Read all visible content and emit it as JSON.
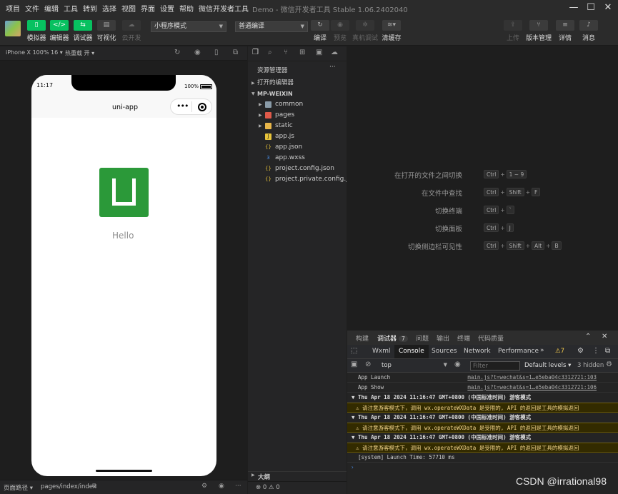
{
  "menu": [
    "项目",
    "文件",
    "编辑",
    "工具",
    "转到",
    "选择",
    "视图",
    "界面",
    "设置",
    "帮助",
    "微信开发者工具"
  ],
  "app_title": "Demo - 微信开发者工具 Stable 1.06.2402040",
  "toolbar": {
    "simulator": "模拟器",
    "editor": "编辑器",
    "debugger": "调试器",
    "visualize": "可视化",
    "cloud": "云开发",
    "mode_select": "小程序模式",
    "compile_select": "普通编译",
    "compile": "编译",
    "preview": "预览",
    "remote_debug": "真机调试",
    "clear_cache": "清缓存",
    "upload": "上传",
    "version": "版本管理",
    "details": "详情",
    "messages": "消息"
  },
  "simbar": {
    "device": "iPhone X 100% 16 ▾",
    "hotreload": "热重载 开 ▾"
  },
  "phone": {
    "time": "11:17",
    "battery": "100%",
    "title": "uni-app",
    "hello": "Hello"
  },
  "sim_status": {
    "path_label": "页面路径 ▾",
    "path": "pages/index/index"
  },
  "explorer": {
    "title": "资源管理器",
    "open_editors": "打开的编辑器",
    "project": "MP-WEIXIN",
    "items": [
      {
        "name": "common",
        "type": "folder"
      },
      {
        "name": "pages",
        "type": "folder-red"
      },
      {
        "name": "static",
        "type": "folder"
      },
      {
        "name": "app.js",
        "type": "js"
      },
      {
        "name": "app.json",
        "type": "json"
      },
      {
        "name": "app.wxss",
        "type": "wxss"
      },
      {
        "name": "project.config.json",
        "type": "json"
      },
      {
        "name": "project.private.config.js...",
        "type": "json"
      }
    ],
    "outline": "大纲",
    "status": "⊗ 0 ⚠ 0"
  },
  "hints": [
    {
      "label": "在打开的文件之间切换",
      "keys": [
        "Ctrl",
        "1 ~ 9"
      ]
    },
    {
      "label": "在文件中查找",
      "keys": [
        "Ctrl",
        "Shift",
        "F"
      ]
    },
    {
      "label": "切换终端",
      "keys": [
        "Ctrl",
        "`"
      ]
    },
    {
      "label": "切换面板",
      "keys": [
        "Ctrl",
        "J"
      ]
    },
    {
      "label": "切换侧边栏可见性",
      "keys": [
        "Ctrl",
        "Shift",
        "Alt",
        "B"
      ]
    }
  ],
  "devtools": {
    "top_tabs": [
      "构建",
      "调试器",
      "问题",
      "输出",
      "终端",
      "代码质量"
    ],
    "debugger_badge": "7",
    "tabs": [
      "Wxml",
      "Console",
      "Sources",
      "Network",
      "Performance"
    ],
    "warn_count": "⚠7",
    "context": "top",
    "filter_placeholder": "Filter",
    "levels": "Default levels ▾",
    "hidden": "3 hidden",
    "logs": [
      {
        "kind": "plain",
        "text": "App Launch",
        "link": "main.js?t=wechat&s=1…e5eba04c3312721:103"
      },
      {
        "kind": "plain",
        "text": "App Show",
        "link": "main.js?t=wechat&s=1…e5eba04c3312721:106"
      },
      {
        "kind": "group",
        "text": "▼ Thu Apr 18 2024 11:16:47 GMT+0800 (中国标准时间) 游客模式",
        "link": ""
      },
      {
        "kind": "warn",
        "text": "⚠ 请注意游客模式下，调用 wx.operateWXData 是受限的, API 的返回是工具的模拟返回",
        "link": ""
      },
      {
        "kind": "group",
        "text": "▼ Thu Apr 18 2024 11:16:47 GMT+0800 (中国标准时间) 游客模式",
        "link": ""
      },
      {
        "kind": "warn",
        "text": "⚠ 请注意游客模式下，调用 wx.operateWXData 是受限的, API 的返回是工具的模拟返回",
        "link": ""
      },
      {
        "kind": "group",
        "text": "▼ Thu Apr 18 2024 11:16:47 GMT+0800 (中国标准时间) 游客模式",
        "link": ""
      },
      {
        "kind": "warn",
        "text": "⚠ 请注意游客模式下，调用 wx.operateWXData 是受限的, API 的返回是工具的模拟返回",
        "link": ""
      },
      {
        "kind": "plain",
        "text": "[system] Launch Time: 57710 ms",
        "link": ""
      }
    ],
    "prompt": "›"
  },
  "watermark": "CSDN @irrational98"
}
